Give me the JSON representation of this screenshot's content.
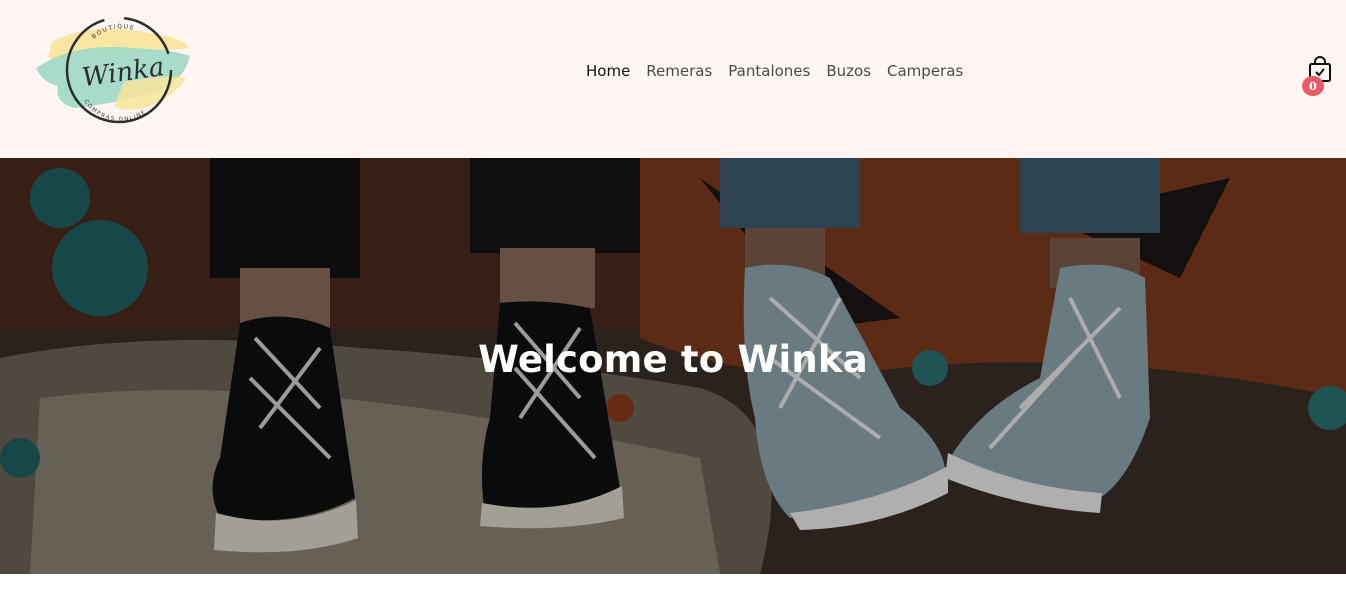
{
  "brand": {
    "name": "Winka",
    "tagline_top": "BOUTIQUE",
    "tagline_bottom": "COMPRAS ONLINE"
  },
  "nav": {
    "items": [
      {
        "label": "Home",
        "active": true
      },
      {
        "label": "Remeras",
        "active": false
      },
      {
        "label": "Pantalones",
        "active": false
      },
      {
        "label": "Buzos",
        "active": false
      },
      {
        "label": "Camperas",
        "active": false
      }
    ]
  },
  "cart": {
    "icon": "shopping-bag-icon",
    "count": "0",
    "badge_color": "#e35d6a"
  },
  "hero": {
    "title": "Welcome to Winka",
    "image": "sneakers-on-graffiti-wall"
  },
  "colors": {
    "header_bg": "#fff6f4",
    "logo_mint": "#9fd8c8",
    "logo_yellow": "#f8e49a"
  }
}
